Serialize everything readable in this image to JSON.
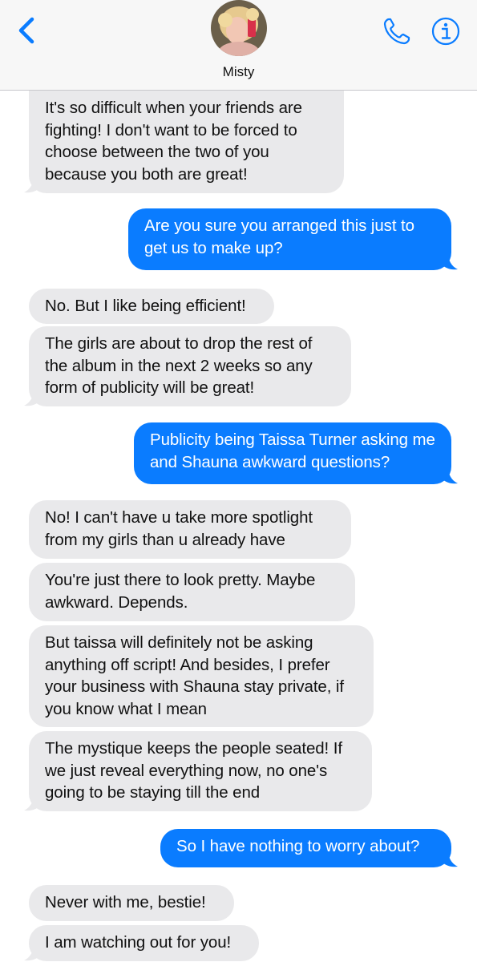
{
  "header": {
    "contact_name": "Misty",
    "back_icon": "chevron-left-icon",
    "phone_icon": "phone-icon",
    "info_icon": "info-icon",
    "accent_color": "#0a7cff"
  },
  "messages": [
    {
      "direction": "in",
      "text": "It's so difficult when your friends are fighting! I don't want to be forced to choose between the two of you because you both are great!",
      "tail": true
    },
    {
      "direction": "out",
      "text": "Are you sure you arranged this just to get us to make up?",
      "tail": true
    },
    {
      "direction": "in",
      "text": "No. But I like being efficient!",
      "tail": false
    },
    {
      "direction": "in",
      "text": "The girls are about to drop the rest of the album in the next 2 weeks so any form of publicity will be great!",
      "tail": true
    },
    {
      "direction": "out",
      "text": "Publicity being Taissa Turner asking me and Shauna awkward questions?",
      "tail": true
    },
    {
      "direction": "in",
      "text": "No! I can't have u take more spotlight from my girls than u already have",
      "tail": false
    },
    {
      "direction": "in",
      "text": "You're just there to look pretty. Maybe awkward. Depends.",
      "tail": false
    },
    {
      "direction": "in",
      "text": "But taissa will definitely not be asking anything off script! And besides, I prefer your business with Shauna stay private, if you know what I mean",
      "tail": false
    },
    {
      "direction": "in",
      "text": "The mystique keeps the people seated! If we just reveal everything now, no one's going to be staying till the end",
      "tail": true
    },
    {
      "direction": "out",
      "text": "So I have nothing to worry about?",
      "tail": true
    },
    {
      "direction": "in",
      "text": "Never with me, bestie!",
      "tail": false
    },
    {
      "direction": "in",
      "text": "I am watching out for you!",
      "tail": true
    }
  ]
}
